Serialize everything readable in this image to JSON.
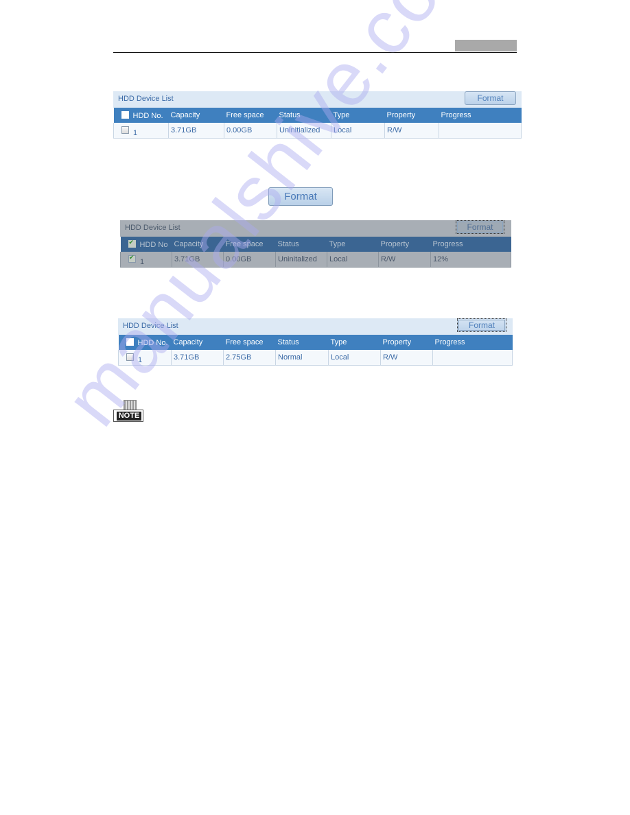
{
  "page_header": {
    "rule": true
  },
  "panels": [
    {
      "title": "HDD Device List",
      "format_label": "Format",
      "state": "uninitialized",
      "columns": [
        "HDD No.",
        "Capacity",
        "Free space",
        "Status",
        "Type",
        "Property",
        "Progress"
      ],
      "rows": [
        {
          "checked": false,
          "hdd_no": "1",
          "capacity": "3.71GB",
          "free_space": "0.00GB",
          "status": "Uninitialized",
          "type": "Local",
          "property": "R/W",
          "progress": ""
        }
      ]
    },
    {
      "title": "HDD Device List",
      "format_label": "Format",
      "state": "formatting",
      "columns": [
        "HDD No",
        "Capacity",
        "Free space",
        "Status",
        "Type",
        "Property",
        "Progress"
      ],
      "rows": [
        {
          "checked": true,
          "hdd_no": "1",
          "capacity": "3.71GB",
          "free_space": "0.00GB",
          "status": "Uninitalized",
          "type": "Local",
          "property": "R/W",
          "progress": "12%"
        }
      ]
    },
    {
      "title": "HDD Device List",
      "format_label": "Format",
      "state": "normal",
      "columns": [
        "HDD No.",
        "Capacity",
        "Free space",
        "Status",
        "Type",
        "Property",
        "Progress"
      ],
      "rows": [
        {
          "checked": false,
          "hdd_no": "1",
          "capacity": "3.71GB",
          "free_space": "2.75GB",
          "status": "Normal",
          "type": "Local",
          "property": "R/W",
          "progress": ""
        }
      ]
    }
  ],
  "standalone_button": {
    "label": "Format"
  },
  "note": {
    "icon": "note-icon",
    "label": "NOTE"
  },
  "watermark": {
    "text": "manualshive.com"
  },
  "colors": {
    "header_blue": "#3f80bf",
    "title_bar": "#dde9f5",
    "text_blue": "#3b6aa6",
    "dim_overlay": "#a8aeb5"
  }
}
